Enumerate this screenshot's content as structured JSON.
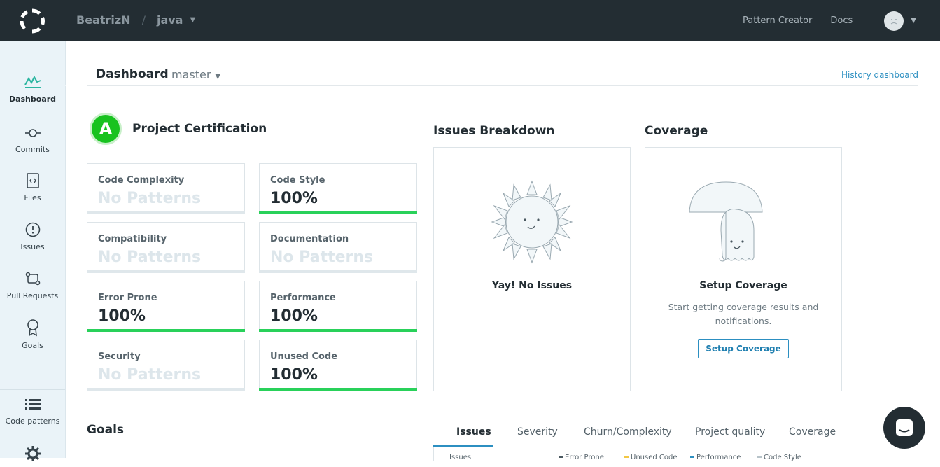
{
  "header": {
    "user": "BeatrizN",
    "separator": "/",
    "repo": "java",
    "links": [
      "Pattern Creator",
      "Docs"
    ]
  },
  "sidebar": {
    "items": [
      {
        "label": "Dashboard",
        "icon": "dashboard-chart-icon"
      },
      {
        "label": "Commits",
        "icon": "commit-icon"
      },
      {
        "label": "Files",
        "icon": "file-code-icon"
      },
      {
        "label": "Issues",
        "icon": "exclamation-circle-icon"
      },
      {
        "label": "Pull Requests",
        "icon": "pull-request-icon"
      },
      {
        "label": "Goals",
        "icon": "goal-ribbon-icon"
      },
      {
        "label": "Code patterns",
        "icon": "list-icon"
      },
      {
        "label": "",
        "icon": "gear-icon"
      }
    ]
  },
  "dashboard": {
    "title": "Dashboard",
    "branch": "master",
    "history_link": "History dashboard"
  },
  "certification": {
    "grade": "A",
    "title": "Project Certification",
    "cards": [
      {
        "label": "Code Complexity",
        "value": "No Patterns",
        "fill": 0
      },
      {
        "label": "Code Style",
        "value": "100%",
        "fill": 1
      },
      {
        "label": "Compatibility",
        "value": "No Patterns",
        "fill": 0
      },
      {
        "label": "Documentation",
        "value": "No Patterns",
        "fill": 0
      },
      {
        "label": "Error Prone",
        "value": "100%",
        "fill": 1
      },
      {
        "label": "Performance",
        "value": "100%",
        "fill": 1
      },
      {
        "label": "Security",
        "value": "No Patterns",
        "fill": 0
      },
      {
        "label": "Unused Code",
        "value": "100%",
        "fill": 1
      }
    ]
  },
  "issues_breakdown": {
    "title": "Issues Breakdown",
    "message": "Yay! No Issues"
  },
  "coverage": {
    "title": "Coverage",
    "heading": "Setup Coverage",
    "description_line1": "Start getting coverage results and",
    "description_line2": "notifications.",
    "button": "Setup Coverage"
  },
  "goals": {
    "title": "Goals"
  },
  "tabs": {
    "items": [
      "Issues",
      "Severity",
      "Churn/Complexity",
      "Project quality",
      "Coverage"
    ],
    "active": "Issues"
  },
  "legend": {
    "title": "Issues",
    "items": [
      "Error Prone",
      "Unused Code",
      "Performance",
      "Code Style"
    ]
  },
  "colors": {
    "topbar": "#232d33",
    "sidebar": "#eaf3f8",
    "accent": "#2c8fc1",
    "success": "#29d15a",
    "grade": "#18c21f"
  }
}
